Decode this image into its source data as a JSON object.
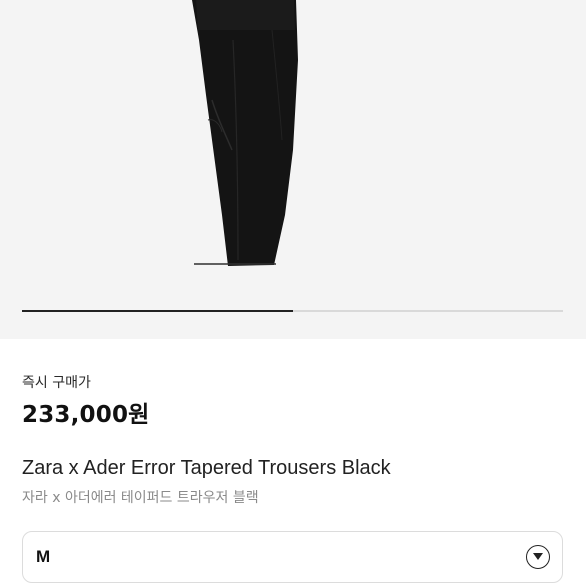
{
  "gallery": {
    "image": "black-trousers",
    "progress": 0.5
  },
  "price": {
    "label": "즉시 구매가",
    "value": "233,000원"
  },
  "product": {
    "name_en": "Zara x Ader Error Tapered Trousers Black",
    "name_ko": "자라 x 아더에러 테이퍼드 트라우저 블랙"
  },
  "size_select": {
    "value": "M",
    "icon": "chevron-down-icon"
  },
  "colors": {
    "gallery_bg": "#f4f4f4",
    "progress_fill": "#222222",
    "progress_track": "#d9d9d9"
  }
}
